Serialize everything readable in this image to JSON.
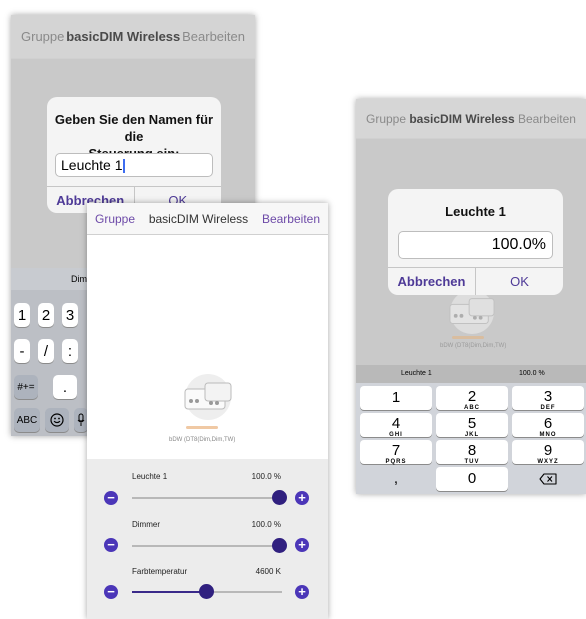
{
  "nav": {
    "left": "Gruppe",
    "title": "basicDIM Wireless",
    "right": "Bearbeiten"
  },
  "left_screen": {
    "alert": {
      "title_line1": "Geben Sie den Namen für die",
      "title_line2": "Steuerung ein:",
      "input_value": "Leuchte 1",
      "cancel": "Abbrechen",
      "ok": "OK"
    },
    "predictive_word": "Dimme",
    "keys_row1": [
      "1",
      "2",
      "3"
    ],
    "keys_row2": [
      "-",
      "/",
      ":"
    ],
    "keys_row3": [
      "#+=",
      "."
    ],
    "keys_row4": [
      "ABC"
    ],
    "emoji_icon": "emoji-icon",
    "mic_icon": "microphone-icon"
  },
  "middle_screen": {
    "device_label": "bDW (DT8(Dim,Dim,TW)",
    "sliders": [
      {
        "label": "Leuchte 1",
        "value": "100.0 %",
        "position": 1.0
      },
      {
        "label": "Dimmer",
        "value": "100.0 %",
        "position": 1.0
      },
      {
        "label": "Farbtemperatur",
        "value": "4600 K",
        "position": 0.5
      }
    ],
    "minus_icon": "minus-icon",
    "plus_icon": "plus-icon"
  },
  "right_screen": {
    "alert": {
      "title": "Leuchte 1",
      "input_value": "100.0%",
      "cancel": "Abbrechen",
      "ok": "OK"
    },
    "device_label": "bDW (DT8(Dim,Dim,TW)",
    "bar_label": "Leuchte 1",
    "bar_value": "100.0 %",
    "numpad": [
      {
        "digit": "1",
        "letters": ""
      },
      {
        "digit": "2",
        "letters": "ABC"
      },
      {
        "digit": "3",
        "letters": "DEF"
      },
      {
        "digit": "4",
        "letters": "GHI"
      },
      {
        "digit": "5",
        "letters": "JKL"
      },
      {
        "digit": "6",
        "letters": "MNO"
      },
      {
        "digit": "7",
        "letters": "PQRS"
      },
      {
        "digit": "8",
        "letters": "TUV"
      },
      {
        "digit": "9",
        "letters": "WXYZ"
      }
    ],
    "comma_key": ",",
    "zero_key": "0",
    "backspace_icon": "backspace-icon"
  },
  "colors": {
    "accent": "#4b36b8",
    "link": "#6d4aa8",
    "dark_thumb": "#30207f",
    "keyboard_bg": "#d1d4da"
  }
}
